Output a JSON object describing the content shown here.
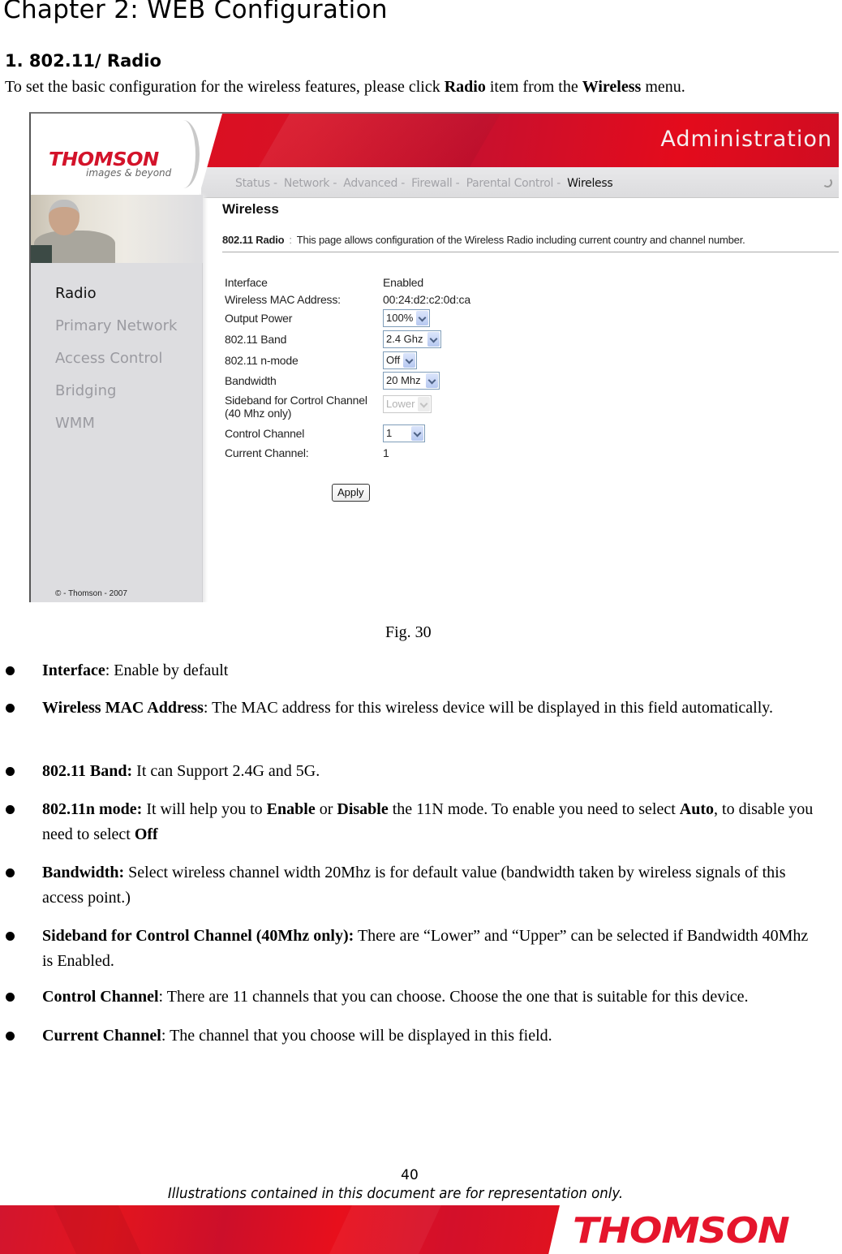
{
  "document": {
    "chapter_title": "Chapter 2: WEB Configuration",
    "section_title": "1.  802.11/ Radio",
    "intro": {
      "prefix": "To set the basic configuration for the wireless features, please click ",
      "bold1": "Radio",
      "middle": " item from the ",
      "bold2": "Wireless",
      "suffix": " menu."
    },
    "figure_caption": "Fig. 30",
    "page_number": "40",
    "disclaimer": "Illustrations contained in this document are for representation only.",
    "footer_logo": "THOMSON"
  },
  "screenshot": {
    "logo": "THOMSON",
    "logo_tagline": "images & beyond",
    "header_title": "Administration",
    "nav": [
      {
        "label": "Status -"
      },
      {
        "label": "Network -"
      },
      {
        "label": "Advanced -"
      },
      {
        "label": "Firewall -"
      },
      {
        "label": "Parental Control -"
      },
      {
        "label": "Wireless",
        "active": true
      }
    ],
    "sidebar": [
      {
        "label": "Radio",
        "active": true
      },
      {
        "label": "Primary Network"
      },
      {
        "label": "Access Control"
      },
      {
        "label": "Bridging"
      },
      {
        "label": "WMM"
      }
    ],
    "copyright": "© - Thomson - 2007",
    "page_title": "Wireless",
    "desc_label": "802.11 Radio",
    "desc_sep": ":",
    "desc_text": "This page allows configuration of the Wireless Radio including current country and channel number.",
    "form": {
      "interface_label": "Interface",
      "interface_value": "Enabled",
      "mac_label": "Wireless MAC Address:",
      "mac_value": "00:24:d2:c2:0d:ca",
      "output_power_label": "Output Power",
      "output_power_value": "100%",
      "band_label": "802.11 Band",
      "band_value": "2.4 Ghz",
      "nmode_label": "802.11 n-mode",
      "nmode_value": "Off",
      "bandwidth_label": "Bandwidth",
      "bandwidth_value": "20 Mhz",
      "sideband_label_1": "Sideband for Cortrol Channel",
      "sideband_label_2": "(40 Mhz only)",
      "sideband_value": "Lower",
      "control_channel_label": "Control Channel",
      "control_channel_value": "1",
      "current_channel_label": "Current Channel:",
      "current_channel_value": "1",
      "apply_label": "Apply"
    }
  },
  "bullets": [
    {
      "bold": "Interface",
      "text": ": Enable by default"
    },
    {
      "bold": "Wireless MAC Address",
      "text": ": The MAC address for this wireless device will be displayed in this field automatically."
    },
    {
      "bold": "802.11 Band:",
      "text": " It can Support 2.4G and 5G."
    },
    {
      "parts": [
        {
          "b": "802.11n mode:"
        },
        {
          "t": " It will help you to "
        },
        {
          "b": "Enable"
        },
        {
          "t": " or "
        },
        {
          "b": "Disable"
        },
        {
          "t": " the 11N mode. To enable you need to select "
        },
        {
          "b": "Auto"
        },
        {
          "t": ", to disable you need to select "
        },
        {
          "b": "Off"
        }
      ]
    },
    {
      "bold": "Bandwidth:",
      "text": " Select wireless channel width 20Mhz is for default value (bandwidth taken by wireless signals of this access point.)"
    },
    {
      "bold": "Sideband for Control Channel (40Mhz only):",
      "text": " There are “Lower” and “Upper” can be selected if Bandwidth 40Mhz is Enabled."
    },
    {
      "bold": "Control Channel",
      "text": ": There are 11 channels that you can choose. Choose the one that is suitable for this device."
    },
    {
      "bold": "Current Channel",
      "text": ": The channel that you choose will be displayed in this field."
    }
  ]
}
